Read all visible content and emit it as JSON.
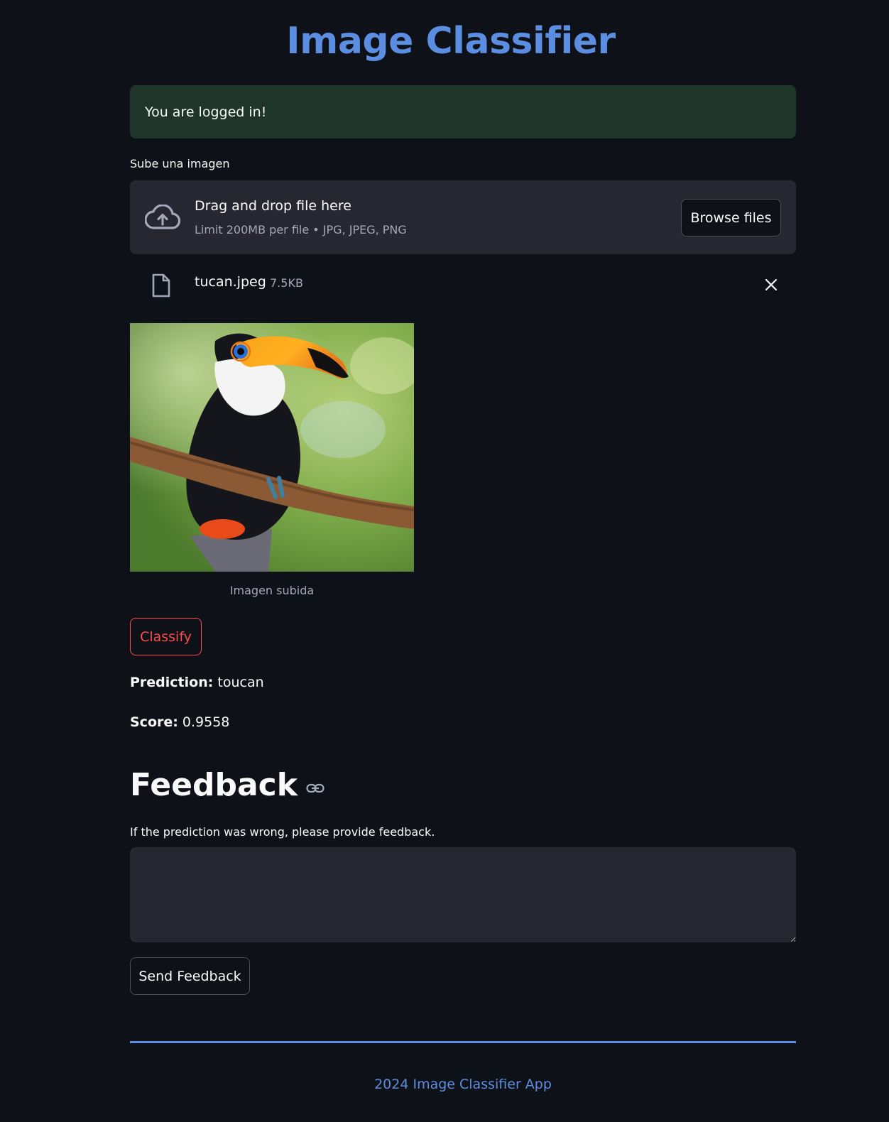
{
  "app": {
    "title": "Image Classifier"
  },
  "alert": {
    "text": "You are logged in!",
    "color": "#1f3529"
  },
  "uploader": {
    "label": "Sube una imagen",
    "drop_text": "Drag and drop file here",
    "limit_text": "Limit 200MB per file • JPG, JPEG, PNG",
    "browse_label": "Browse files",
    "icon": "cloud-upload-icon"
  },
  "uploaded_file": {
    "name": "tucan.jpeg",
    "size": "7.5KB",
    "icon": "file-icon",
    "remove_icon": "close-icon"
  },
  "image": {
    "caption": "Imagen subida"
  },
  "classify": {
    "label": "Classify",
    "color": "#ff4b4b"
  },
  "result": {
    "prediction_label": "Prediction:",
    "prediction_value": "toucan",
    "score_label": "Score:",
    "score_value": "0.9558"
  },
  "feedback": {
    "heading": "Feedback",
    "heading_icon": "link-icon",
    "prompt": "If the prediction was wrong, please provide feedback.",
    "value": "",
    "send_label": "Send Feedback"
  },
  "footer": {
    "text": "2024 Image Classifier App"
  },
  "theme": {
    "background": "#0e1117",
    "accent": "#5b8ee0",
    "surface": "#262730"
  }
}
